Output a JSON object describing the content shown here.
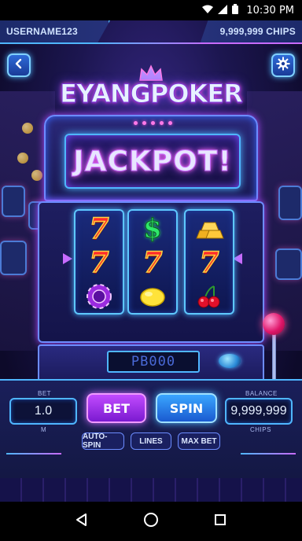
{
  "status_bar": {
    "time": "10:30 PM"
  },
  "hud": {
    "username": "USERNAME123",
    "chips": "9,999,999 CHIPS"
  },
  "logo": {
    "title": "EYANGPOKER"
  },
  "machine": {
    "jackpot_text": "JACKPOT!",
    "reels": [
      [
        "seven",
        "seven",
        "poker-chip"
      ],
      [
        "dollar-sign",
        "seven",
        "lemon"
      ],
      [
        "gold-bars",
        "seven",
        "cherries"
      ]
    ],
    "seven_glyph": "7",
    "dollar_glyph": "$",
    "credit_display": "PB000"
  },
  "controls": {
    "bet_label": "BET",
    "bet_value": "1.0",
    "bet_unit": "M",
    "bet_button": "BET",
    "spin_button": "SPIN",
    "balance_label": "BALANCE",
    "balance_value": "9,999,999",
    "balance_unit": "CHIPS",
    "auto_spin": "AUTO-SPIN",
    "lines": "LINES",
    "max_bet": "MAX BET"
  },
  "colors": {
    "accent_blue": "#4fb6ff",
    "accent_purple": "#c86bff",
    "jackpot_pink": "#ff6adf"
  }
}
